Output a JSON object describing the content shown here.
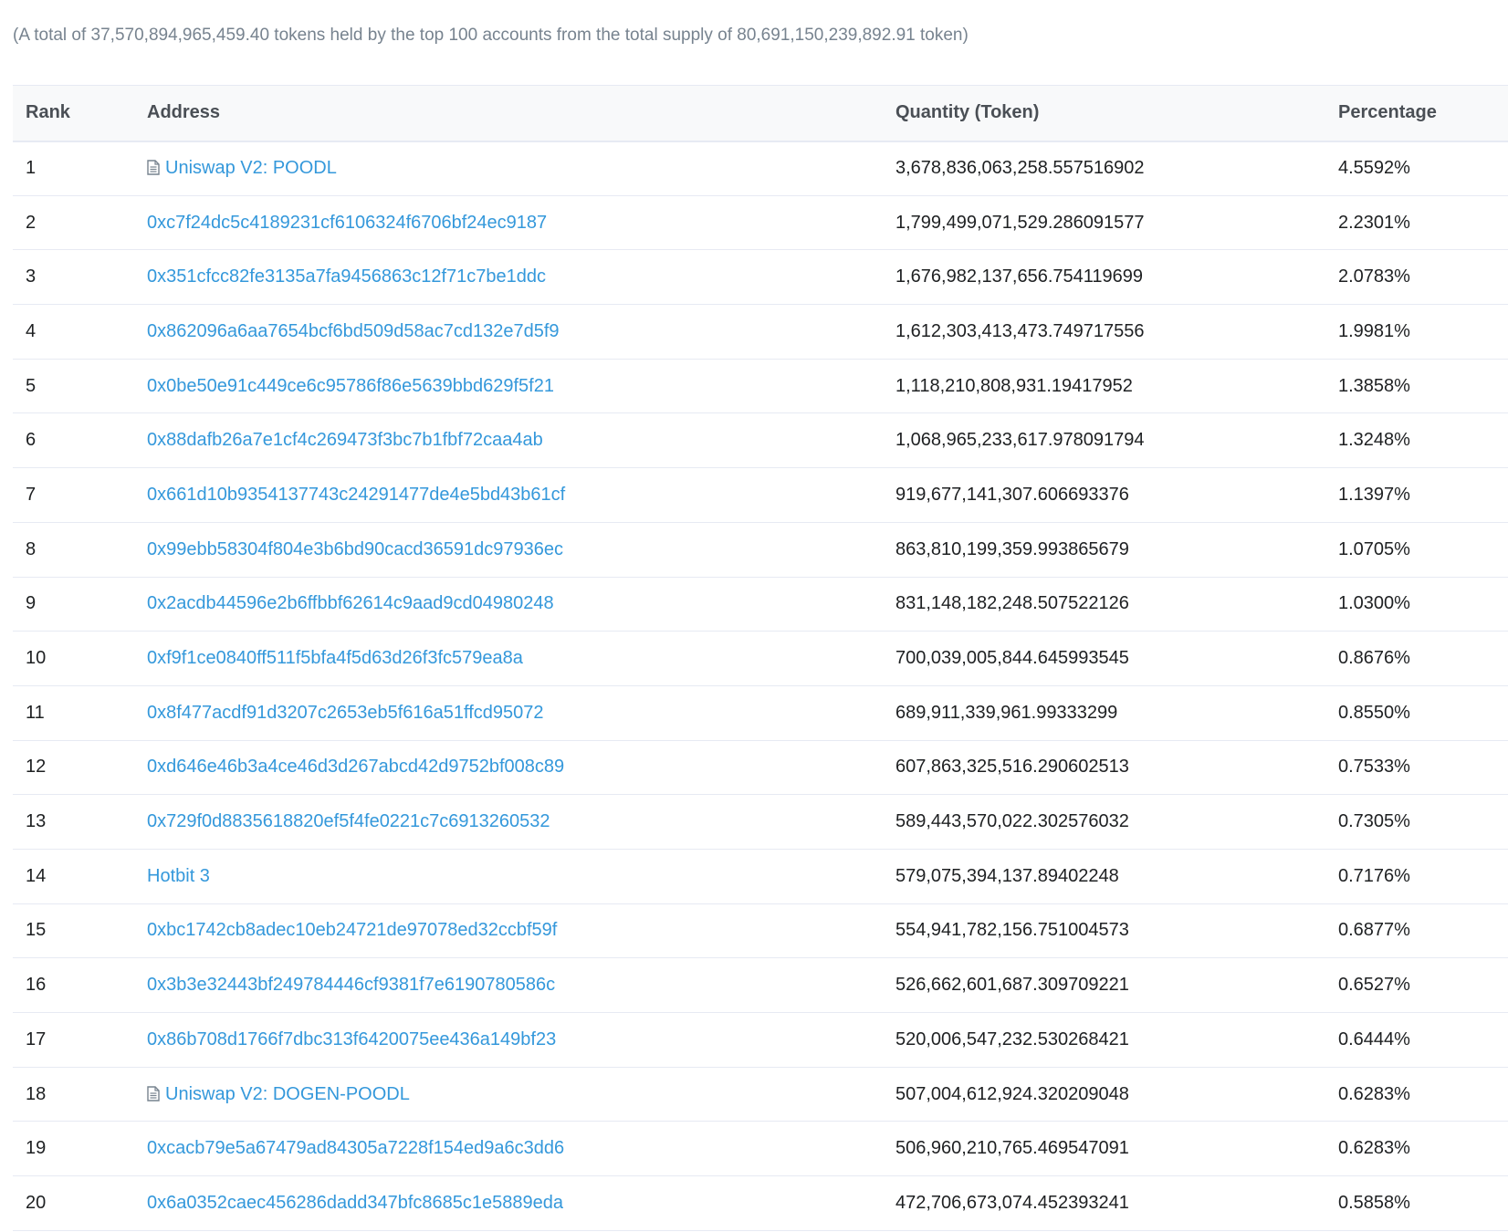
{
  "summary": "(A total of 37,570,894,965,459.40 tokens held by the top 100 accounts from the total supply of 80,691,150,239,892.91 token)",
  "table": {
    "headers": {
      "rank": "Rank",
      "address": "Address",
      "quantity": "Quantity (Token)",
      "percentage": "Percentage"
    },
    "rows": [
      {
        "rank": "1",
        "address": "Uniswap V2: POODL",
        "contract": true,
        "quantity": "3,678,836,063,258.557516902",
        "percentage": "4.5592%"
      },
      {
        "rank": "2",
        "address": "0xc7f24dc5c4189231cf6106324f6706bf24ec9187",
        "contract": false,
        "quantity": "1,799,499,071,529.286091577",
        "percentage": "2.2301%"
      },
      {
        "rank": "3",
        "address": "0x351cfcc82fe3135a7fa9456863c12f71c7be1ddc",
        "contract": false,
        "quantity": "1,676,982,137,656.754119699",
        "percentage": "2.0783%"
      },
      {
        "rank": "4",
        "address": "0x862096a6aa7654bcf6bd509d58ac7cd132e7d5f9",
        "contract": false,
        "quantity": "1,612,303,413,473.749717556",
        "percentage": "1.9981%"
      },
      {
        "rank": "5",
        "address": "0x0be50e91c449ce6c95786f86e5639bbd629f5f21",
        "contract": false,
        "quantity": "1,118,210,808,931.19417952",
        "percentage": "1.3858%"
      },
      {
        "rank": "6",
        "address": "0x88dafb26a7e1cf4c269473f3bc7b1fbf72caa4ab",
        "contract": false,
        "quantity": "1,068,965,233,617.978091794",
        "percentage": "1.3248%"
      },
      {
        "rank": "7",
        "address": "0x661d10b9354137743c24291477de4e5bd43b61cf",
        "contract": false,
        "quantity": "919,677,141,307.606693376",
        "percentage": "1.1397%"
      },
      {
        "rank": "8",
        "address": "0x99ebb58304f804e3b6bd90cacd36591dc97936ec",
        "contract": false,
        "quantity": "863,810,199,359.993865679",
        "percentage": "1.0705%"
      },
      {
        "rank": "9",
        "address": "0x2acdb44596e2b6ffbbf62614c9aad9cd04980248",
        "contract": false,
        "quantity": "831,148,182,248.507522126",
        "percentage": "1.0300%"
      },
      {
        "rank": "10",
        "address": "0xf9f1ce0840ff511f5bfa4f5d63d26f3fc579ea8a",
        "contract": false,
        "quantity": "700,039,005,844.645993545",
        "percentage": "0.8676%"
      },
      {
        "rank": "11",
        "address": "0x8f477acdf91d3207c2653eb5f616a51ffcd95072",
        "contract": false,
        "quantity": "689,911,339,961.99333299",
        "percentage": "0.8550%"
      },
      {
        "rank": "12",
        "address": "0xd646e46b3a4ce46d3d267abcd42d9752bf008c89",
        "contract": false,
        "quantity": "607,863,325,516.290602513",
        "percentage": "0.7533%"
      },
      {
        "rank": "13",
        "address": "0x729f0d8835618820ef5f4fe0221c7c6913260532",
        "contract": false,
        "quantity": "589,443,570,022.302576032",
        "percentage": "0.7305%"
      },
      {
        "rank": "14",
        "address": "Hotbit 3",
        "contract": false,
        "quantity": "579,075,394,137.89402248",
        "percentage": "0.7176%"
      },
      {
        "rank": "15",
        "address": "0xbc1742cb8adec10eb24721de97078ed32ccbf59f",
        "contract": false,
        "quantity": "554,941,782,156.751004573",
        "percentage": "0.6877%"
      },
      {
        "rank": "16",
        "address": "0x3b3e32443bf249784446cf9381f7e6190780586c",
        "contract": false,
        "quantity": "526,662,601,687.309709221",
        "percentage": "0.6527%"
      },
      {
        "rank": "17",
        "address": "0x86b708d1766f7dbc313f6420075ee436a149bf23",
        "contract": false,
        "quantity": "520,006,547,232.530268421",
        "percentage": "0.6444%"
      },
      {
        "rank": "18",
        "address": "Uniswap V2: DOGEN-POODL",
        "contract": true,
        "quantity": "507,004,612,924.320209048",
        "percentage": "0.6283%"
      },
      {
        "rank": "19",
        "address": "0xcacb79e5a67479ad84305a7228f154ed9a6c3dd6",
        "contract": false,
        "quantity": "506,960,210,765.469547091",
        "percentage": "0.6283%"
      },
      {
        "rank": "20",
        "address": "0x6a0352caec456286dadd347bfc8685c1e5889eda",
        "contract": false,
        "quantity": "472,706,673,074.452393241",
        "percentage": "0.5858%"
      }
    ]
  },
  "colors": {
    "link": "#3498db",
    "muted": "#77838f",
    "header_bg": "#f8f9fa",
    "border": "#e7eaf3"
  },
  "icons": {
    "contract": "document-icon"
  }
}
